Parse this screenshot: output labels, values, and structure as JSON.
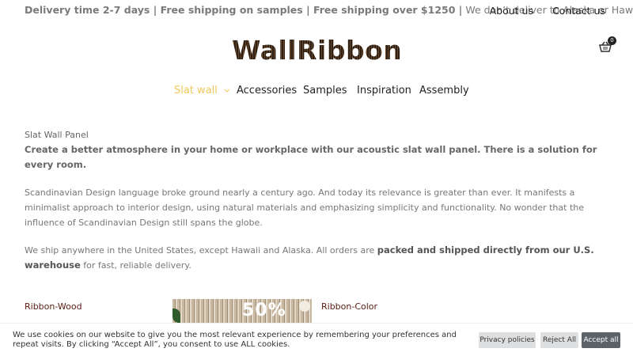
{
  "topbar": {
    "notice_bold": "Delivery time 2-7 days | Free shipping on samples | Free shipping over $1250 |",
    "notice_light": " We don’t deliver to Alaska or Hawaii",
    "links": [
      "About us",
      "Contact us"
    ]
  },
  "logo": {
    "text": "WallRibbon"
  },
  "cart": {
    "count": "0",
    "icon": "basket-icon"
  },
  "nav": {
    "items": [
      "Slat wall",
      "Accessories",
      "Samples",
      "Inspiration",
      "Assembly"
    ],
    "active_color": "#f0c75a"
  },
  "content": {
    "category": "Slat Wall Panel",
    "lead": "Create a better atmosphere in your home or workplace with our acoustic slat wall panel. There is a solution for every room.",
    "paragraph1": "Scandinavian Design language broke ground nearly a century ago. And today its relevance is greater than ever. It manifests a minimalist approach to interior design, using natural materials and emphasizing simplicity and functionality. No wonder that the influence of Scandinavian Design still spans the globe.",
    "paragraph2_start": "We ship anywhere in the United States, except Hawaii and Alaska. All orders are ",
    "paragraph2_bold": "packed and shipped directly from our U.S. warehouse",
    "paragraph2_end": " for fast, reliable delivery."
  },
  "products": {
    "left_label": "Ribbon-Wood",
    "promo_text": "50%",
    "right_label": "Ribbon-Color"
  },
  "cookie": {
    "message": "We use cookies on our website to give you the most relevant experience by remembering your preferences and repeat visits. By clicking “Accept All”, you consent to use ALL cookies.",
    "privacy_label": "Privacy policies",
    "reject_label": "Reject All",
    "accept_label": "Accept all"
  }
}
